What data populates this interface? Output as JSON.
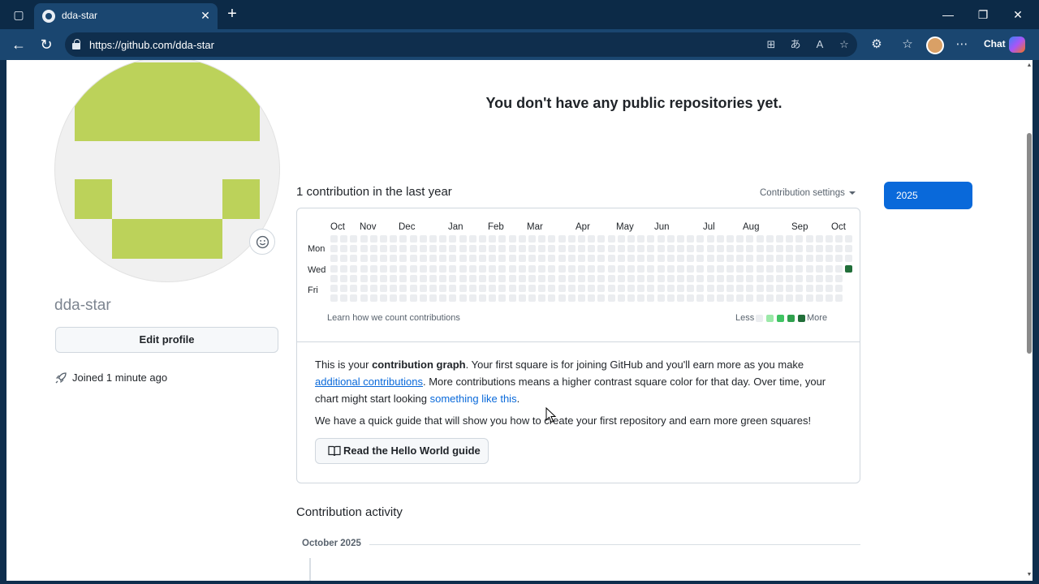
{
  "browser": {
    "tab_title": "dda-star",
    "url": "https://github.com/dda-star",
    "chat_label": "Chat",
    "icons": [
      "tab-actions-icon",
      "close-icon",
      "new-tab-icon",
      "minimize-icon",
      "restore-icon",
      "window-close-icon",
      "back-icon",
      "refresh-icon",
      "lock-icon",
      "app-available-icon",
      "translate-icon",
      "read-aloud-icon",
      "favorite-star-icon",
      "extensions-icon",
      "favorites-icon",
      "profile-avatar",
      "more-icon",
      "copilot-icon"
    ]
  },
  "profile": {
    "username": "dda-star",
    "edit_label": "Edit profile",
    "joined": "Joined 1 minute ago",
    "identicon_color": "#bcd25a"
  },
  "main": {
    "no_repos": "You don't have any public repositories yet.",
    "contrib_count": "1 contribution in the last year",
    "contrib_settings": "Contribution settings",
    "year": "2025"
  },
  "graph": {
    "months": [
      "Oct",
      "Nov",
      "Dec",
      "Jan",
      "Feb",
      "Mar",
      "Apr",
      "May",
      "Jun",
      "Jul",
      "Aug",
      "Sep",
      "Oct"
    ],
    "days": [
      "Mon",
      "Wed",
      "Fri"
    ],
    "learn_link": "Learn how we count contributions",
    "legend_less": "Less",
    "legend_more": "More",
    "legend_colors": [
      "#ebedf0",
      "#9be9a8",
      "#40c463",
      "#30a14e",
      "#216e39"
    ],
    "active_cell": {
      "week": 52,
      "day": "Wed",
      "level": 4
    }
  },
  "info": {
    "p1_a": "This is your ",
    "p1_bold": "contribution graph",
    "p1_b": ". Your first square is for joining GitHub and you'll earn more as you make ",
    "p1_link1": "additional contributions",
    "p1_c": ". More contributions means a higher contrast square color for that day. Over time, your chart might start looking ",
    "p1_link2": "something like this",
    "p1_d": ".",
    "p2": "We have a quick guide that will show you how to create your first repository and earn more green squares!",
    "guide_label": "Read the Hello World guide"
  },
  "activity": {
    "title": "Contribution activity",
    "month": "October 2025"
  }
}
